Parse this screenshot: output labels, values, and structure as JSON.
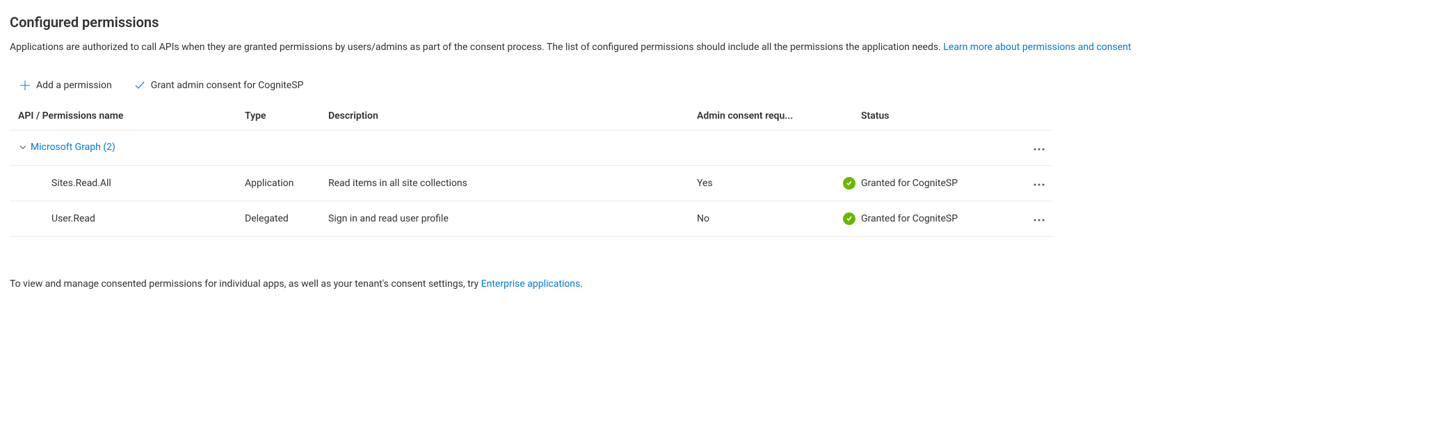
{
  "header": {
    "title": "Configured permissions",
    "description_part1": "Applications are authorized to call APIs when they are granted permissions by users/admins as part of the consent process. The list of configured permissions should include all the permissions the application needs. ",
    "learn_more": "Learn more about permissions and consent"
  },
  "toolbar": {
    "add_permission": "Add a permission",
    "grant_consent": "Grant admin consent for CogniteSP"
  },
  "table": {
    "columns": {
      "name": "API / Permissions name",
      "type": "Type",
      "description": "Description",
      "admin_consent": "Admin consent requ...",
      "status": "Status"
    },
    "group": {
      "label": "Microsoft Graph (2)"
    },
    "rows": [
      {
        "name": "Sites.Read.All",
        "type": "Application",
        "description": "Read items in all site collections",
        "admin_consent": "Yes",
        "status": "Granted for CogniteSP"
      },
      {
        "name": "User.Read",
        "type": "Delegated",
        "description": "Sign in and read user profile",
        "admin_consent": "No",
        "status": "Granted for CogniteSP"
      }
    ]
  },
  "footer": {
    "text_part1": "To view and manage consented permissions for individual apps, as well as your tenant's consent settings, try ",
    "link": "Enterprise applications",
    "text_part2": "."
  }
}
